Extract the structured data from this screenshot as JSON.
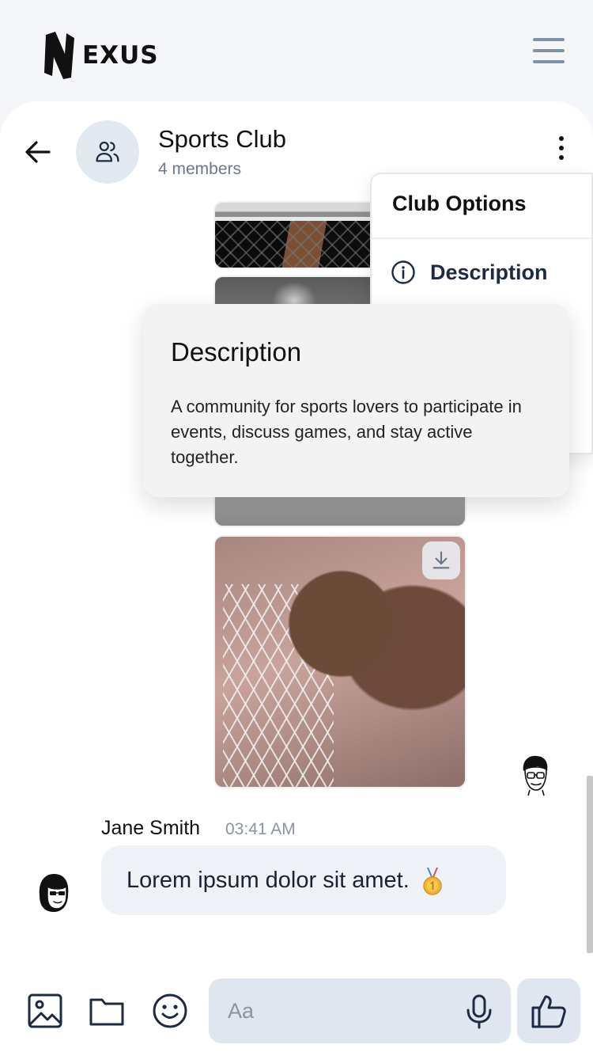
{
  "header": {
    "logo_text": "EXUS",
    "menu_icon": "hamburger-icon"
  },
  "chat": {
    "group_name": "Sports Club",
    "members": "4 members",
    "back_icon": "arrow-left-icon",
    "avatar_icon": "users-icon",
    "more_icon": "more-vertical-icon"
  },
  "media": {
    "download_icon": "download-icon"
  },
  "message": {
    "sender": "Jane Smith",
    "time": "03:41 AM",
    "text": "Lorem ipsum dolor sit amet.",
    "emoji_icon": "medal-emoji"
  },
  "composer": {
    "placeholder": "Aa",
    "image_icon": "image-icon",
    "folder_icon": "folder-icon",
    "emoji_icon": "smiley-icon",
    "mic_icon": "microphone-icon",
    "like_icon": "thumbs-up-icon"
  },
  "options_menu": {
    "title": "Club Options",
    "items": [
      {
        "label": "Description",
        "icon": "info-icon"
      }
    ]
  },
  "description_popup": {
    "title": "Description",
    "body": "A community for sports lovers to participate in events, discuss games, and stay active together."
  },
  "colors": {
    "page_bg": "#f4f6fa",
    "muted_text": "#6a7890",
    "bubble_bg": "#eff3f8",
    "input_bg": "#dfe6ef",
    "menu_icon": "#8192a8"
  }
}
